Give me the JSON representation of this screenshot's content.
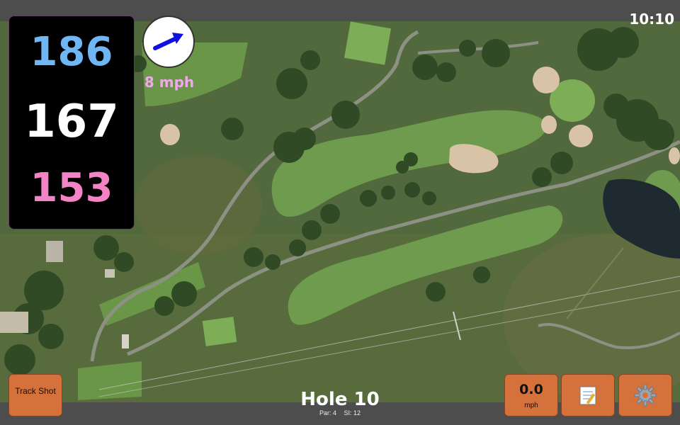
{
  "clock": "10:10",
  "distances": {
    "back": "186",
    "middle": "167",
    "front": "153"
  },
  "wind": {
    "speed": "8 mph",
    "direction_icon": "wind-arrow-icon"
  },
  "buttons": {
    "track_shot": "Track Shot",
    "speed_value": "0.0",
    "speed_unit": "mph",
    "notes_icon": "notepad-icon",
    "settings_icon": "gear-icon"
  },
  "hole": {
    "title": "Hole 10",
    "par": "Par: 4",
    "si": "SI: 12"
  },
  "colors": {
    "back": "#6fb6f5",
    "middle": "#ffffff",
    "front": "#f283c4",
    "wind_text": "#f2a6ef",
    "wind_arrow": "#1010e0",
    "button": "#d5713a"
  }
}
